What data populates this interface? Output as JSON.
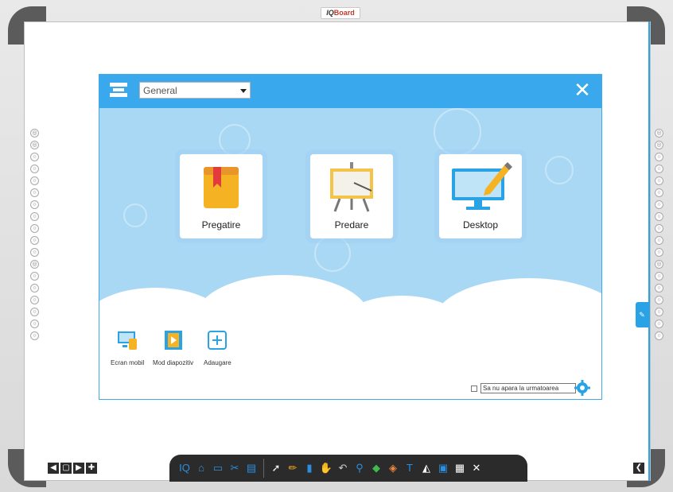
{
  "brand": {
    "prefix": "IQ",
    "name": "Board"
  },
  "dialog": {
    "category_select": "General",
    "close_label": "✕",
    "tiles": [
      {
        "label": "Pregatire",
        "icon": "book-icon"
      },
      {
        "label": "Predare",
        "icon": "presentation-board-icon"
      },
      {
        "label": "Desktop",
        "icon": "desktop-pencil-icon"
      }
    ],
    "bottom_buttons": [
      {
        "label": "Ecran mobil",
        "icon": "mobile-screen-icon"
      },
      {
        "label": "Mod diapozitiv",
        "icon": "slideshow-icon"
      },
      {
        "label": "Adaugare",
        "icon": "add-icon"
      }
    ],
    "dont_show_label": "Sa nu apara la urmatoarea",
    "settings_icon": "gear-icon"
  },
  "side_tools": [
    "◎",
    "◎",
    "○",
    "○",
    "○",
    "○",
    "○",
    "○",
    "○",
    "○",
    "○",
    "◎",
    "○",
    "○",
    "○",
    "○",
    "○",
    "○"
  ],
  "pager": {
    "prev": "◀",
    "page": "▢",
    "next": "▶",
    "add": "✚"
  },
  "collapse_label": "❮",
  "pen_tab": "✎",
  "toolbar": {
    "left_tools": [
      {
        "name": "iq-logo-icon",
        "glyph": "IQ",
        "color": "#2a8fe0"
      },
      {
        "name": "home-icon",
        "glyph": "⌂",
        "color": "#2a8fe0"
      },
      {
        "name": "screen-icon",
        "glyph": "▭",
        "color": "#2a8fe0"
      },
      {
        "name": "tools-icon",
        "glyph": "✂",
        "color": "#2a8fe0"
      },
      {
        "name": "keyboard-icon",
        "glyph": "▤",
        "color": "#2a8fe0"
      }
    ],
    "right_tools": [
      {
        "name": "cursor-icon",
        "glyph": "➚",
        "color": "#ffffff"
      },
      {
        "name": "pen-icon",
        "glyph": "✏",
        "color": "#f5a623"
      },
      {
        "name": "eraser-icon",
        "glyph": "▮",
        "color": "#2a8fe0"
      },
      {
        "name": "hand-icon",
        "glyph": "✋",
        "color": "#f5c542"
      },
      {
        "name": "undo-icon",
        "glyph": "↶",
        "color": "#cccccc"
      },
      {
        "name": "zoom-icon",
        "glyph": "⚲",
        "color": "#2a8fe0"
      },
      {
        "name": "shapes-icon",
        "glyph": "◆",
        "color": "#3fb950"
      },
      {
        "name": "fill-icon",
        "glyph": "◈",
        "color": "#f0883e"
      },
      {
        "name": "text-icon",
        "glyph": "T",
        "color": "#2a8fe0"
      },
      {
        "name": "spotlight-icon",
        "glyph": "◭",
        "color": "#ffffff"
      },
      {
        "name": "camera-icon",
        "glyph": "▣",
        "color": "#2a8fe0"
      },
      {
        "name": "grid-icon",
        "glyph": "▦",
        "color": "#ffffff"
      },
      {
        "name": "close-toolbar-icon",
        "glyph": "✕",
        "color": "#ffffff"
      }
    ]
  }
}
